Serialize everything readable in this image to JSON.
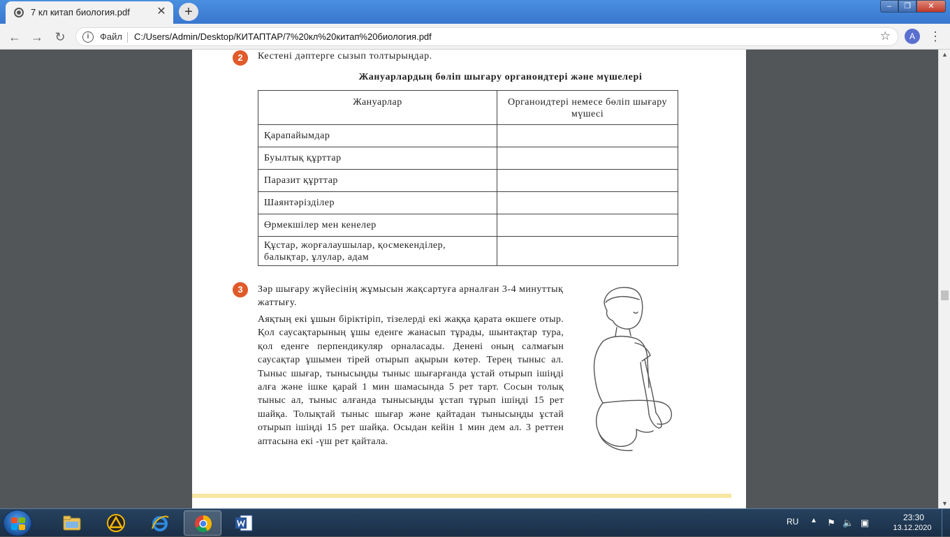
{
  "browser": {
    "tab_title": "7 кл китап биология.pdf",
    "tab_close_glyph": "✕",
    "newtab_glyph": "+",
    "scheme_label": "Файл",
    "url": "C:/Users/Admin/Desktop/КИТАПТАР/7%20кл%20китап%20биология.pdf",
    "avatar_letter": "A",
    "window_controls": {
      "minimize": "–",
      "maximize": "❐",
      "close": "✕"
    }
  },
  "document": {
    "task2": {
      "number": "2",
      "instruction": "Кестені  дəптерге  сызып  толтырыңдар."
    },
    "table_title": "Жануарлардың  бөліп  шығару  органоидтері  жəне  мүшелері",
    "table": {
      "headers": [
        "Жануарлар",
        "Органоидтері  немесе  бөліп шығару  мүшесі"
      ],
      "rows": [
        "Қарапайымдар",
        "Буылтық  құрттар",
        "Паразит  құрттар",
        "Шаянтəрізділер",
        "Өрмекшілер  мен  кенелер",
        "Құстар,  жорғалаушылар,  қосмекенділер, балықтар,  ұлулар,  адам"
      ]
    },
    "task3": {
      "number": "3",
      "title": "Зəр  шығару  жүйесінің  жұмысын  жақсартуға  арналған 3-4  минуттық  жаттығу.",
      "body": "Аяқтың  екі  ұшын  біріктіріп,  тізелерді  екі  жаққа  қарата өкшеге  отыр.  Қол  саусақтарының  ұшы  еденге  жанасып тұрады,  шынтақтар  тура,  қол  еденге  перпендикуляр орналасады.  Денені  оның  салмағын  саусақтар  ұшымен тірей  отырып  ақырын  көтер.  Терең  тыныс  ал.  Тыныс шығар,  тынысыңды  тыныс  шығарғанда  ұстай  отырып ішіңді  алға  жəне  ішке  қарай  1  мин  шамасында  5  рет тарт.  Сосын  толық  тыныс  ал,  тыныс  алғанда  тынысыңды ұстап  тұрып  ішіңді  15  рет  шайқа.  Толықтай  тыныс шығар  жəне  қайтадан  тынысыңды  ұстай  отырып  ішіңді 15  рет  шайқа.  Осыдан  кейін  1 мин  дем  ал.  3  реттен аптасына  екі -үш  рет  қайтала."
    }
  },
  "taskbar": {
    "language": "RU",
    "time": "23:30",
    "date": "13.12.2020"
  },
  "colors": {
    "badge": "#e05a2a",
    "titlebar": "#3877cf",
    "taskbar": "#1a2f47"
  }
}
